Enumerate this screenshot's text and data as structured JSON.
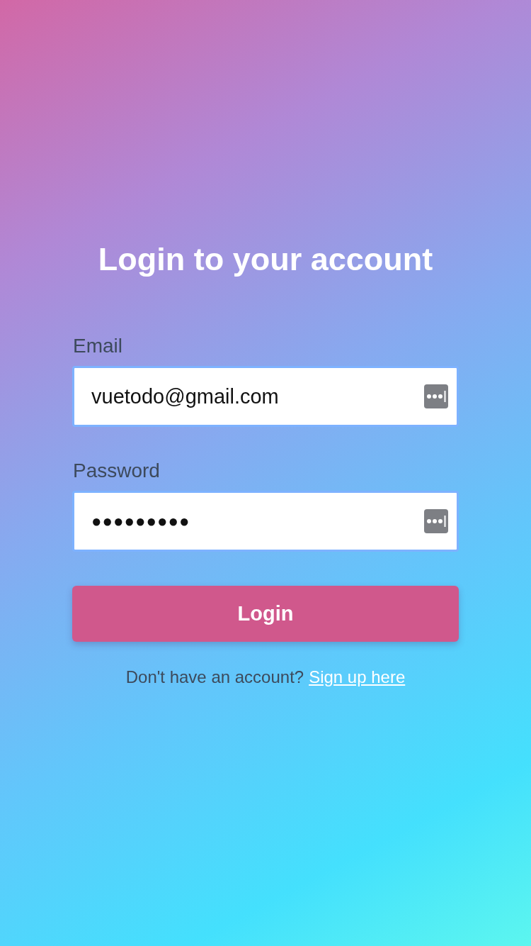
{
  "title": "Login to your account",
  "fields": [
    {
      "label": "Email",
      "value": "vuetodo@gmail.com",
      "kind": "text"
    },
    {
      "label": "Password",
      "value": "●●●●●●●●●",
      "kind": "password"
    }
  ],
  "login_button": "Login",
  "footer": {
    "text": "Don't have an account?",
    "link": "Sign up here"
  }
}
